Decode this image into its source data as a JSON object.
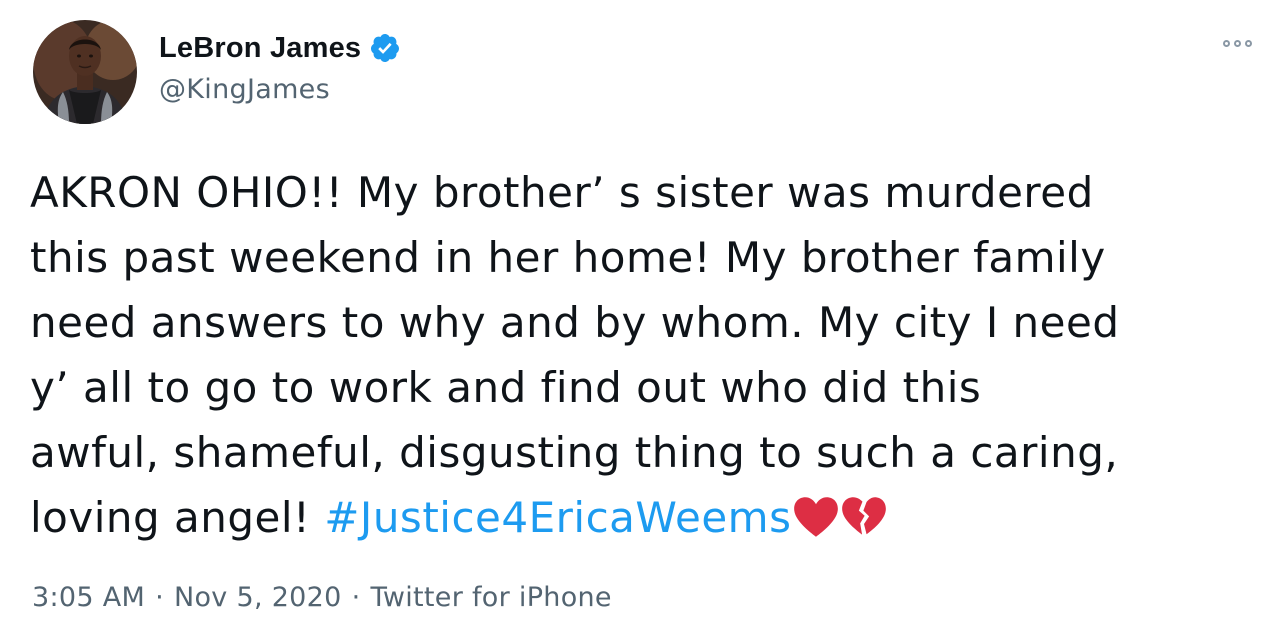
{
  "author": {
    "display_name": "LeBron James",
    "handle": "@KingJames",
    "verified": true
  },
  "tweet": {
    "lines": [
      "AKRON OHIO!! My brother’ s sister was murdered",
      "this past weekend in her home! My brother family",
      "need answers to why and by whom. My city I need",
      "y’ all to go to work and find out who did this",
      "awful, shameful, disgusting thing to such a caring,"
    ],
    "last_line_text": "loving angel! ",
    "hashtag": "#Justice4EricaWeems",
    "emojis": [
      "red-heart",
      "broken-heart"
    ]
  },
  "meta": {
    "time": "3:05 AM",
    "separator": "·",
    "date": "Nov 5, 2020",
    "source": "Twitter for iPhone"
  },
  "colors": {
    "text": "#0f1419",
    "secondary": "#536471",
    "link": "#1d9bf0",
    "verified": "#1d9bf0",
    "heart": "#e0245e"
  },
  "icons": {
    "more": "more-horizontal-icon",
    "verified": "verified-badge-icon"
  }
}
